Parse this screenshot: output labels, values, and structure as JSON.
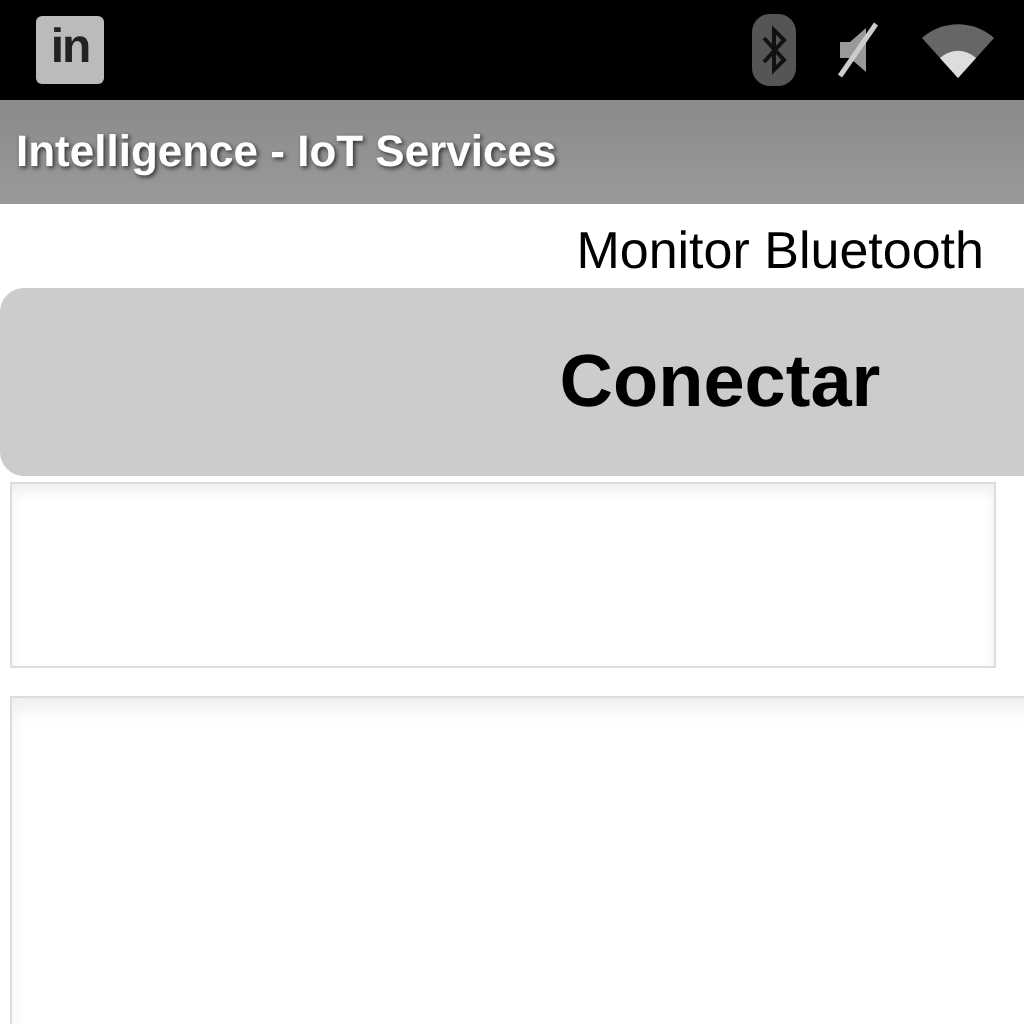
{
  "status_bar": {
    "notification_icon": "in"
  },
  "title_bar": {
    "title": "Intelligence - IoT Services"
  },
  "header": {
    "label": "Monitor Bluetooth"
  },
  "connect_button": {
    "label": "Conectar"
  },
  "fields": [
    {
      "kind": "single"
    },
    {
      "kind": "multi"
    }
  ]
}
